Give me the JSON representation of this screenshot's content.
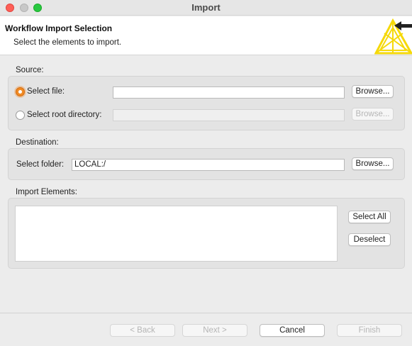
{
  "window": {
    "title": "Import"
  },
  "header": {
    "title": "Workflow Import Selection",
    "description": "Select the elements to import."
  },
  "source": {
    "label": "Source:",
    "select_file_label": "Select file:",
    "select_file_value": "",
    "select_root_label": "Select root directory:",
    "select_root_value": "",
    "browse_file_label": "Browse...",
    "browse_root_label": "Browse..."
  },
  "destination": {
    "label": "Destination:",
    "select_folder_label": "Select folder:",
    "folder_value": "LOCAL:/",
    "browse_label": "Browse..."
  },
  "import_elements": {
    "label": "Import Elements:",
    "select_all_label": "Select All",
    "deselect_label": "Deselect"
  },
  "footer": {
    "back_label": "< Back",
    "next_label": "Next >",
    "cancel_label": "Cancel",
    "finish_label": "Finish"
  },
  "colors": {
    "accent_radio": "#f08a24",
    "logo_yellow": "#f5d90a"
  }
}
